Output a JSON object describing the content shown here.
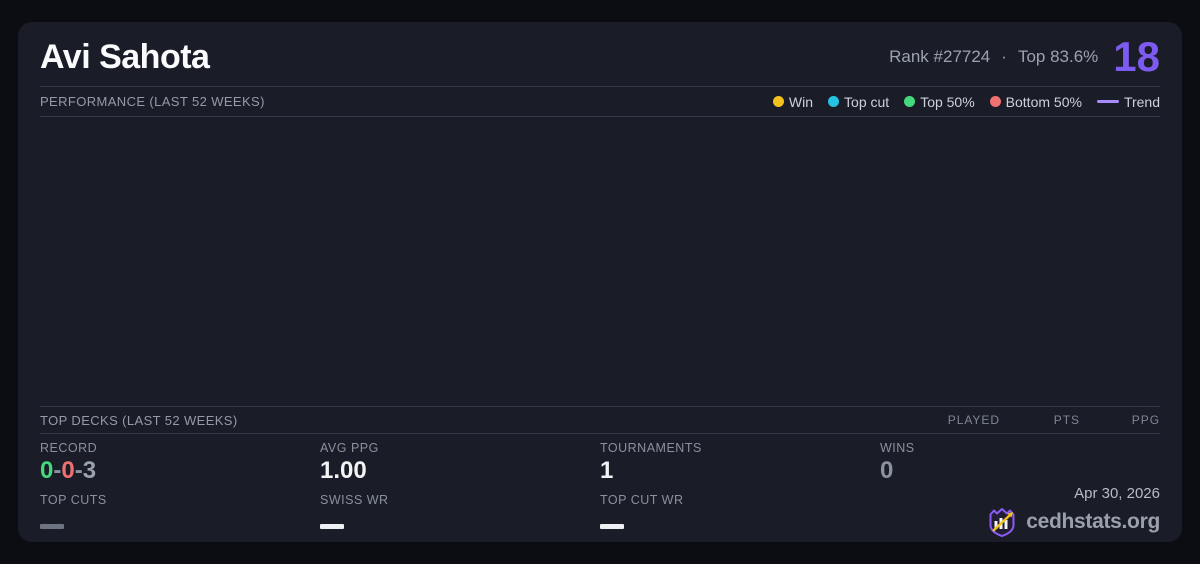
{
  "player": {
    "name": "Avi Sahota",
    "rank_label": "Rank #27724",
    "separator": "·",
    "top_percent": "Top 83.6%",
    "score": "18",
    "score_color": "#7d5bf0"
  },
  "performance": {
    "title": "PERFORMANCE (LAST 52 WEEKS)",
    "legend": [
      {
        "label": "Win",
        "color": "#f2c21d",
        "type": "dot"
      },
      {
        "label": "Top cut",
        "color": "#25c2e3",
        "type": "dot"
      },
      {
        "label": "Top 50%",
        "color": "#44d97d",
        "type": "dot"
      },
      {
        "label": "Bottom 50%",
        "color": "#f07171",
        "type": "dot"
      },
      {
        "label": "Trend",
        "color": "#a78bfa",
        "type": "line"
      }
    ]
  },
  "top_decks": {
    "title": "TOP DECKS (LAST 52 WEEKS)",
    "columns": [
      "PLAYED",
      "PTS",
      "PPG"
    ],
    "rows": []
  },
  "stats": {
    "record": {
      "label": "RECORD",
      "wins": "0",
      "losses": "0",
      "draws": "3",
      "separator": "-",
      "wins_color": "#44d97d",
      "losses_color": "#f07171",
      "draws_color": "#9aa2ae"
    },
    "avg_ppg": {
      "label": "AVG PPG",
      "value": "1.00"
    },
    "tournaments": {
      "label": "TOURNAMENTS",
      "value": "1"
    },
    "wins": {
      "label": "WINS",
      "value": "0"
    },
    "top_cuts": {
      "label": "TOP CUTS",
      "value": "—"
    },
    "swiss_wr": {
      "label": "SWISS WR",
      "value": "—"
    },
    "top_cut_wr": {
      "label": "TOP CUT WR",
      "value": "—"
    }
  },
  "footer": {
    "date": "Apr 30, 2026",
    "site": "cedhstats.org"
  }
}
